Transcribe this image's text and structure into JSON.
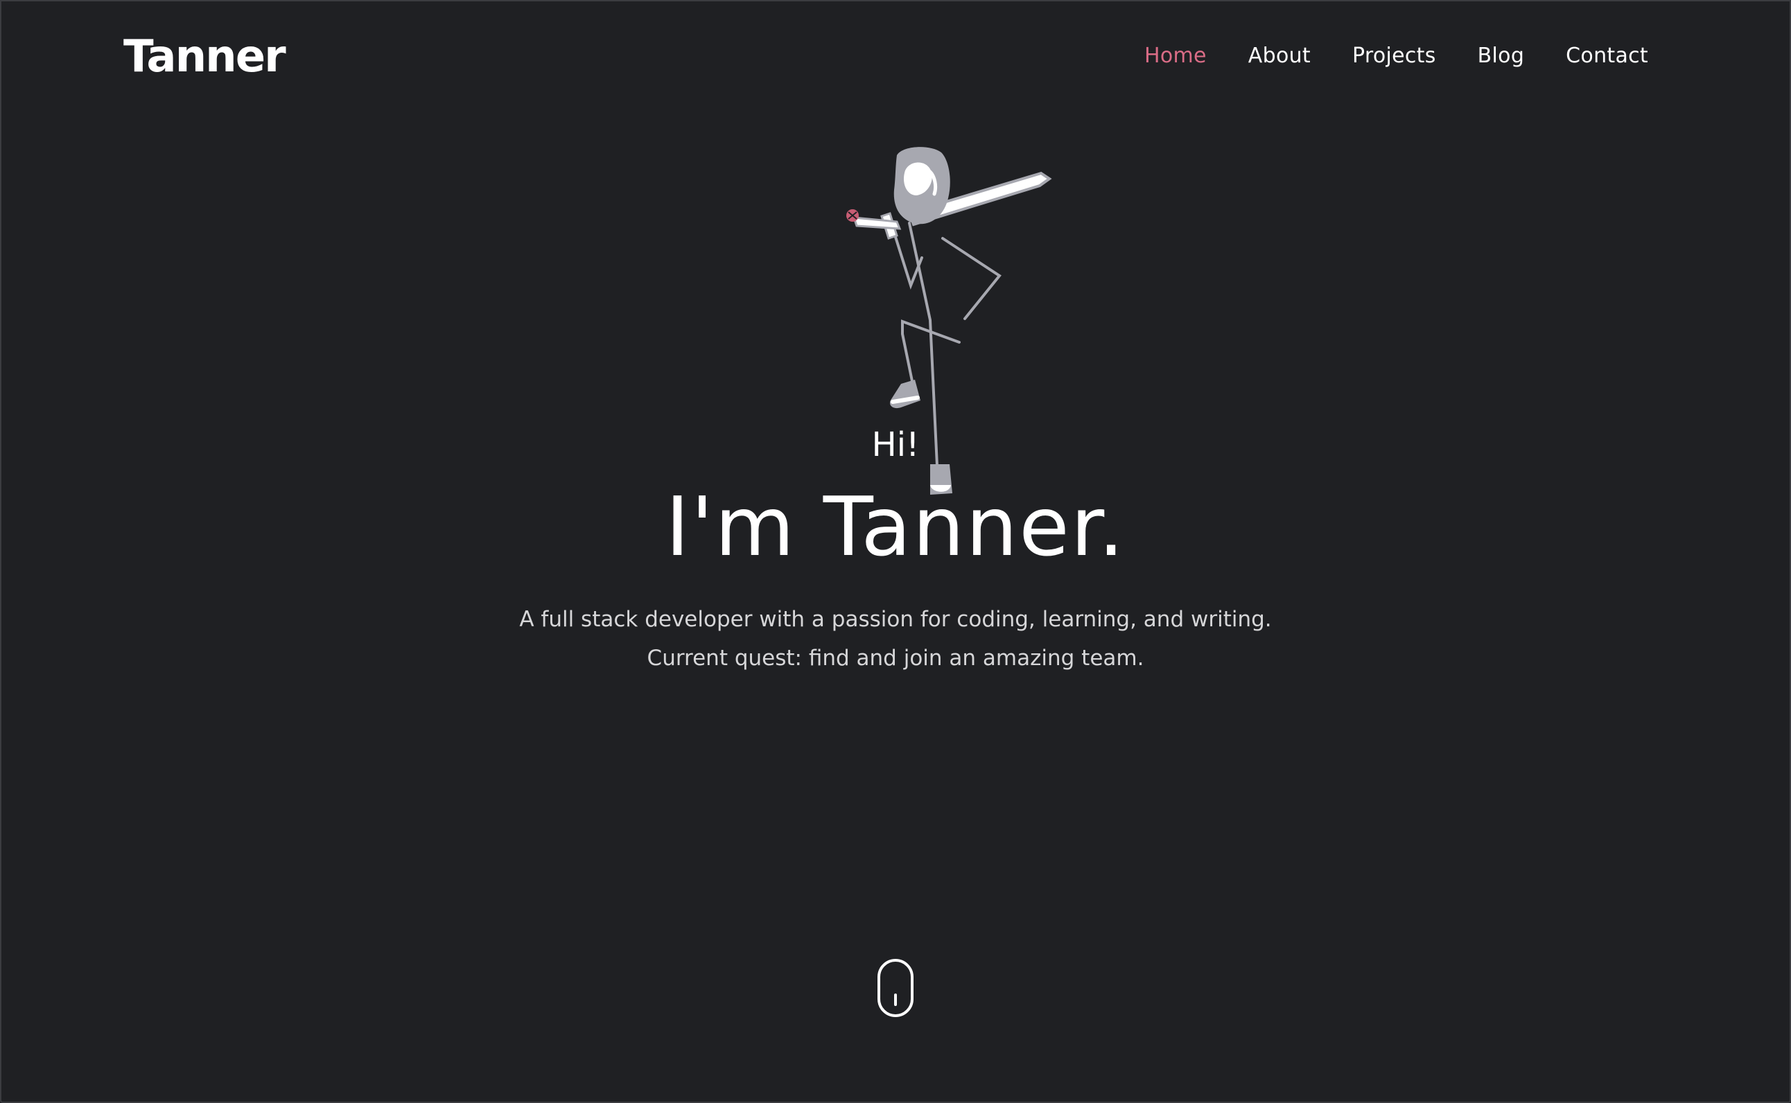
{
  "brand": {
    "logo_text": "Tanner"
  },
  "nav": {
    "items": [
      {
        "label": "Home",
        "active": true
      },
      {
        "label": "About",
        "active": false
      },
      {
        "label": "Projects",
        "active": false
      },
      {
        "label": "Blog",
        "active": false
      },
      {
        "label": "Contact",
        "active": false
      }
    ]
  },
  "hero": {
    "greeting": "Hi!",
    "title": "I'm Tanner.",
    "tagline_line1": "A full stack developer with a passion for coding, learning, and writing.",
    "tagline_line2": "Current quest: find and join an amazing team.",
    "illustration": "stick-figure-with-sword-icon"
  },
  "scroll_indicator": {
    "icon": "mouse-scroll-icon"
  },
  "colors": {
    "background": "#1f2023",
    "accent": "#d96c86",
    "text": "#ffffff",
    "muted_text": "#d6d6d8",
    "illustration_gray": "#a7a8b0"
  }
}
